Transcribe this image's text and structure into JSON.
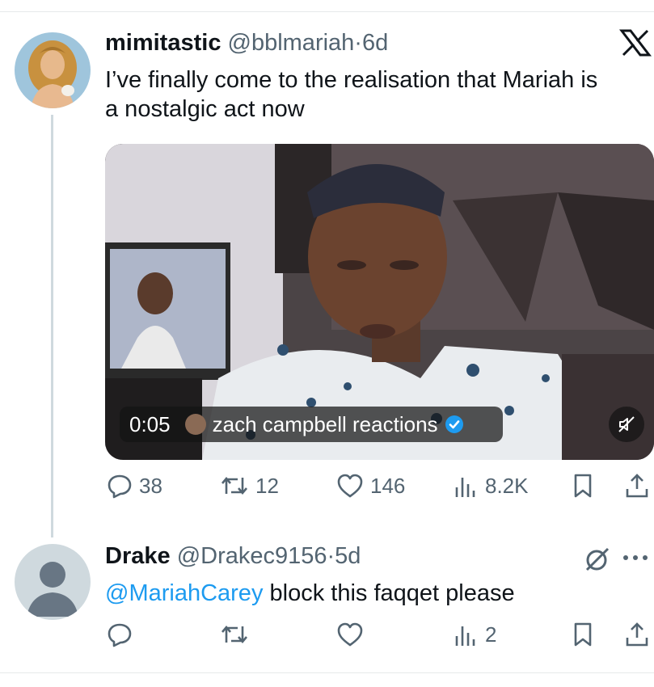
{
  "tweet": {
    "display_name": "mimitastic",
    "handle": "@bblmariah",
    "separator": "·",
    "time": "6d",
    "text_line1": "I’ve finally come to the realisation that Mariah is",
    "text_line2": "a nostalgic act now",
    "platform_icon": "x-logo-icon",
    "video": {
      "timestamp": "0:05",
      "channel": "zach campbell reactions",
      "verified": true,
      "muted": true
    },
    "stats": {
      "replies": "38",
      "reposts": "12",
      "likes": "146",
      "views": "8.2K"
    }
  },
  "reply": {
    "display_name": "Drake",
    "handle": "@Drakec9156",
    "separator": "·",
    "time": "5d",
    "mention": "@MariahCarey",
    "text": " block this faqqet please",
    "stats": {
      "views": "2"
    }
  },
  "colors": {
    "accent": "#1d9bf0",
    "muted_text": "#536471",
    "divider": "#e6e9ea"
  }
}
